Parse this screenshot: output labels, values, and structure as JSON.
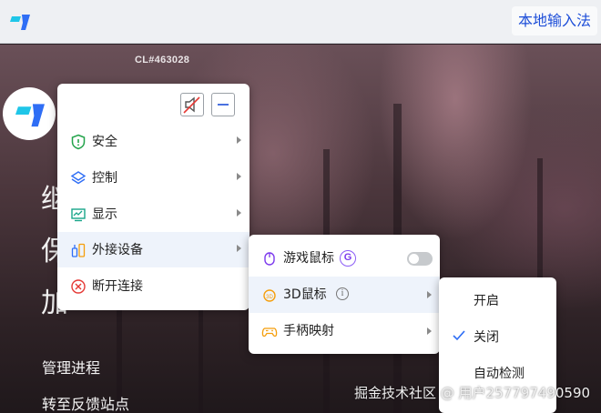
{
  "topbar": {
    "ime_button": "本地输入法"
  },
  "build_id": "CL#463028",
  "background_text": {
    "chars": [
      "继",
      "保",
      "加"
    ],
    "links": [
      "管理进程",
      "转至反馈站点"
    ]
  },
  "menu": {
    "items": [
      {
        "label": "安全",
        "icon": "shield-icon"
      },
      {
        "label": "控制",
        "icon": "layers-icon"
      },
      {
        "label": "显示",
        "icon": "monitor-icon"
      },
      {
        "label": "外接设备",
        "icon": "device-icon",
        "highlighted": true
      },
      {
        "label": "断开连接",
        "icon": "disconnect-icon"
      }
    ]
  },
  "submenu": {
    "items": [
      {
        "label": "游戏鼠标",
        "badge": "G",
        "toggle": false,
        "icon": "mouse-icon"
      },
      {
        "label": "3D鼠标",
        "info": "i",
        "icon": "3d-mouse-icon",
        "icon_text": "3D",
        "highlighted": true
      },
      {
        "label": "手柄映射",
        "icon": "gamepad-icon"
      }
    ]
  },
  "options": {
    "items": [
      {
        "label": "开启",
        "checked": false
      },
      {
        "label": "关闭",
        "checked": true
      },
      {
        "label": "自动检测",
        "checked": false
      }
    ]
  },
  "watermark": "掘金技术社区 @ 用户257797490590",
  "colors": {
    "accent": "#1d4ed8",
    "logo_cyan": "#1fc6e8",
    "logo_blue": "#2f6ef5",
    "highlight": "#eef3fb"
  }
}
